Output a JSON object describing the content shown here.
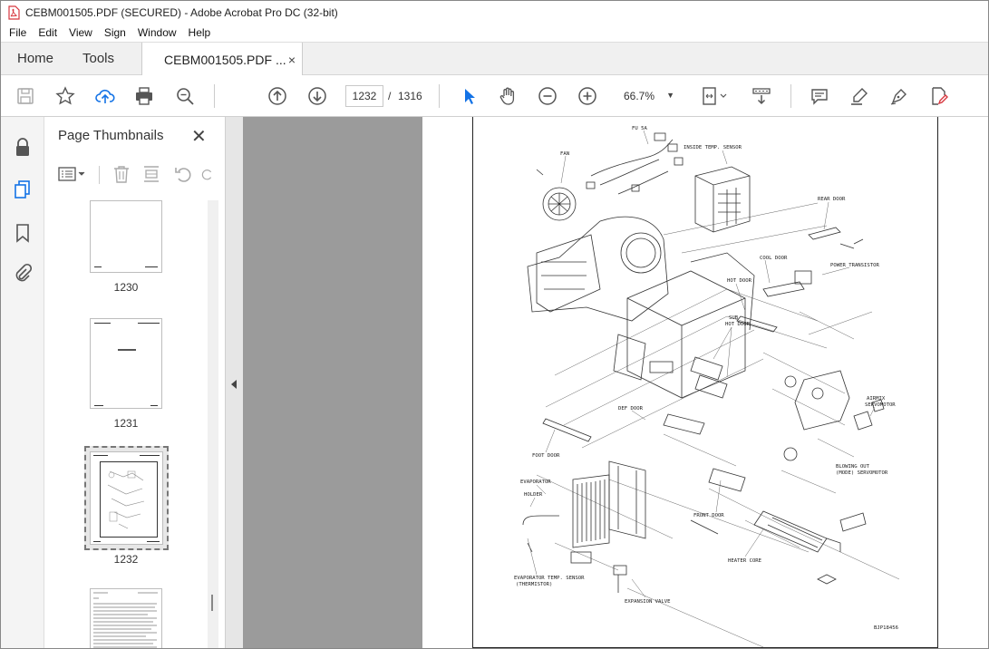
{
  "window": {
    "title": "CEBM001505.PDF (SECURED) - Adobe Acrobat Pro DC (32-bit)"
  },
  "menu": [
    "File",
    "Edit",
    "View",
    "Sign",
    "Window",
    "Help"
  ],
  "tabs": {
    "home": "Home",
    "tools": "Tools",
    "document": "CEBM001505.PDF ...",
    "close_glyph": "×"
  },
  "toolbar": {
    "current_page": "1232",
    "page_separator": "/",
    "total_pages": "1316",
    "zoom": "66.7%"
  },
  "thumbnails_pane": {
    "title": "Page Thumbnails",
    "close_glyph": "✕",
    "pages": [
      {
        "label": "1230"
      },
      {
        "label": "1231"
      },
      {
        "label": "1232",
        "selected": true
      },
      {
        "label": ""
      }
    ]
  },
  "diagram": {
    "labels": {
      "fu5a": "FU 5A",
      "inside_temp": "INSIDE TEMP. SENSOR",
      "fan": "FAN",
      "rear_door": "REAR DOOR",
      "cool_door": "COOL DOOR",
      "power_transistor": "POWER TRANSISTOR",
      "hot_door": "HOT DOOR",
      "sub": "SUB",
      "sub_hot_door": "HOT DOOR",
      "airmix1": "AIRMIX",
      "airmix2": "SERVOMOTOR",
      "def_door": "DEF DOOR",
      "foot_door": "FOOT DOOR",
      "blowing1": "BLOWING OUT",
      "blowing2": "(MODE) SERVOMOTOR",
      "evaporator": "EVAPORATOR",
      "holder": "HOLDER",
      "front_door": "FRONT DOOR",
      "heater_core": "HEATER CORE",
      "evap_sensor1": "EVAPORATOR TEMP. SENSOR",
      "evap_sensor2": "(THERMISTOR)",
      "expansion_valve": "EXPANSION VALVE",
      "code": "BJP18456"
    }
  },
  "colors": {
    "accent_blue": "#1473e6",
    "pdf_red": "#d7373f",
    "doc_gray": "#9b9b9b"
  }
}
